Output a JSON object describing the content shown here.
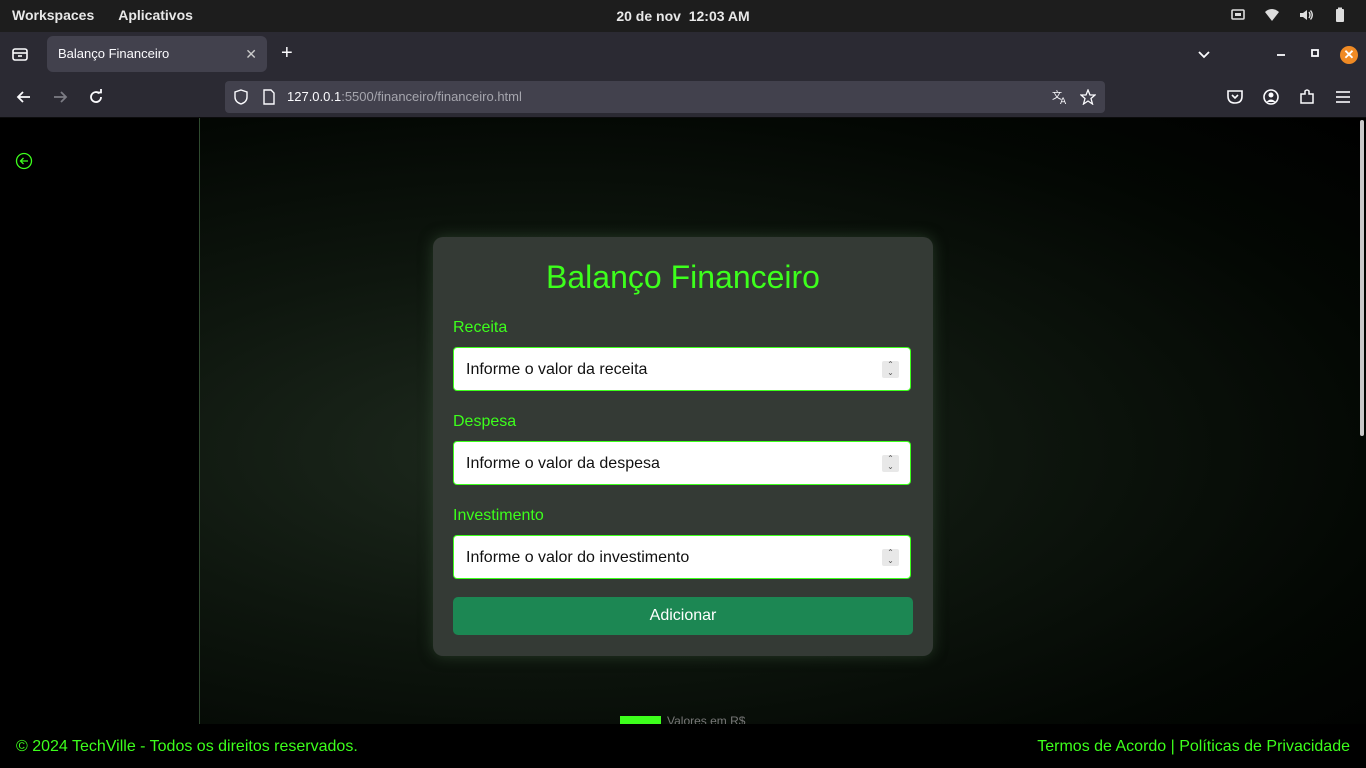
{
  "os": {
    "workspaces": "Workspaces",
    "apps": "Aplicativos",
    "date": "20 de nov",
    "time": "12:03 AM"
  },
  "browser": {
    "tab_title": "Balanço Financeiro",
    "url_host": "127.0.0.1",
    "url_rest": ":5500/financeiro/financeiro.html"
  },
  "card": {
    "title": "Balanço Financeiro",
    "fields": [
      {
        "label": "Receita",
        "placeholder": "Informe o valor da receita"
      },
      {
        "label": "Despesa",
        "placeholder": "Informe o valor da despesa"
      },
      {
        "label": "Investimento",
        "placeholder": "Informe o valor do investimento"
      }
    ],
    "button": "Adicionar"
  },
  "legend": {
    "label": "Valores em R$",
    "color": "#3dff1c"
  },
  "footer": {
    "copyright": "© 2024 TechVille - Todos os direitos reservados.",
    "terms": "Termos de Acordo",
    "separator": " | ",
    "privacy": "Políticas de Privacidade"
  },
  "colors": {
    "accent": "#3dff1c",
    "button": "#1c8753",
    "card": "#343a35"
  }
}
